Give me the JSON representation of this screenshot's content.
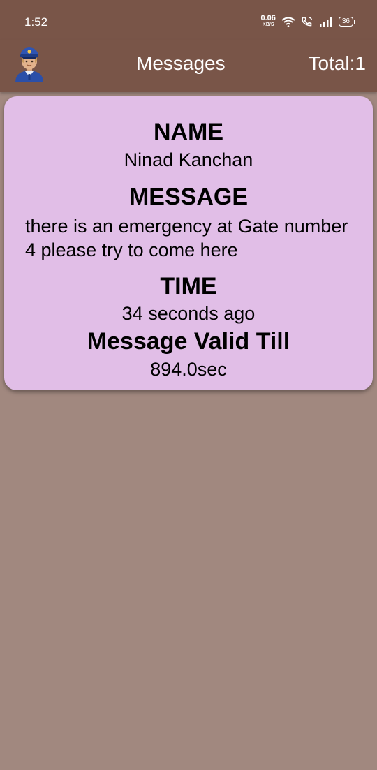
{
  "status_bar": {
    "time": "1:52",
    "net_speed_value": "0.06",
    "net_speed_unit": "KB/S",
    "battery": "36"
  },
  "app_bar": {
    "title": "Messages",
    "total": "Total:1",
    "avatar_icon": "police-officer-icon"
  },
  "message_card": {
    "name_heading": "NAME",
    "name_value": "Ninad Kanchan",
    "message_heading": "MESSAGE",
    "message_value": "there is an emergency at Gate number 4 please try to come here",
    "time_heading": "TIME",
    "time_value": "34 seconds ago",
    "valid_heading": "Message Valid Till",
    "valid_value": "894.0sec"
  },
  "colors": {
    "app_bar": "#795548",
    "background": "#a1887f",
    "card": "#e1bee7"
  }
}
